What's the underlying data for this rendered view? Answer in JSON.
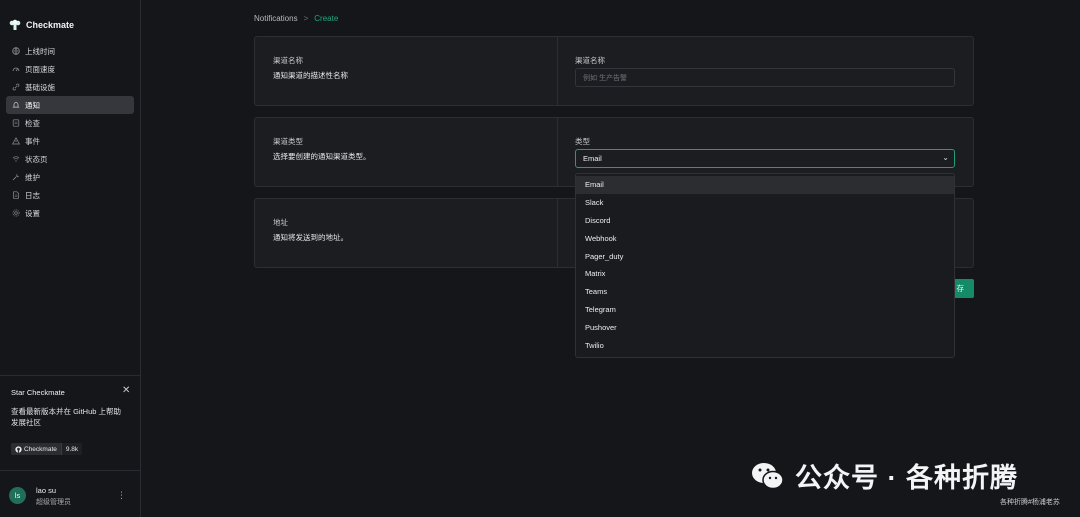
{
  "app": {
    "name": "Checkmate"
  },
  "sidebar": {
    "items": [
      {
        "label": "上线时间",
        "icon": "globe-icon"
      },
      {
        "label": "页面速度",
        "icon": "speed-icon"
      },
      {
        "label": "基础设施",
        "icon": "link-icon"
      },
      {
        "label": "通知",
        "icon": "bell-icon",
        "active": true
      },
      {
        "label": "检查",
        "icon": "check-icon"
      },
      {
        "label": "事件",
        "icon": "warning-icon"
      },
      {
        "label": "状态页",
        "icon": "wifi-icon"
      },
      {
        "label": "维护",
        "icon": "wrench-icon"
      },
      {
        "label": "日志",
        "icon": "log-icon"
      },
      {
        "label": "设置",
        "icon": "settings-icon"
      }
    ]
  },
  "star": {
    "title": "Star Checkmate",
    "description": "查看最新版本并在 GitHub 上帮助发展社区",
    "badge_label": "Checkmate",
    "badge_count": "9.8k"
  },
  "user": {
    "initials": "ls",
    "name": "lao su",
    "role": "超级管理员"
  },
  "breadcrumb": {
    "parent": "Notifications",
    "separator": ">",
    "current": "Create"
  },
  "cards": {
    "name": {
      "label": "渠道名称",
      "description": "通知渠道的描述性名称",
      "field_label": "渠道名称",
      "placeholder": "例如 生产告警"
    },
    "type": {
      "label": "渠道类型",
      "description": "选择要创建的通知渠道类型。",
      "field_label": "类型",
      "value": "Email"
    },
    "address": {
      "label": "地址",
      "description": "通知将发送到的地址。"
    }
  },
  "dropdown": {
    "options": [
      "Email",
      "Slack",
      "Discord",
      "Webhook",
      "Pager_duty",
      "Matrix",
      "Teams",
      "Telegram",
      "Pushover",
      "Twilio"
    ],
    "selected": "Email"
  },
  "save_button": {
    "label": "存"
  },
  "watermark": {
    "text": "公众号 · 各种折腾",
    "small": "各种折腾#杨浦老苏"
  },
  "colors": {
    "accent": "#1e9f78",
    "button": "#158a67",
    "background": "#151619",
    "card": "#1c1d21"
  }
}
